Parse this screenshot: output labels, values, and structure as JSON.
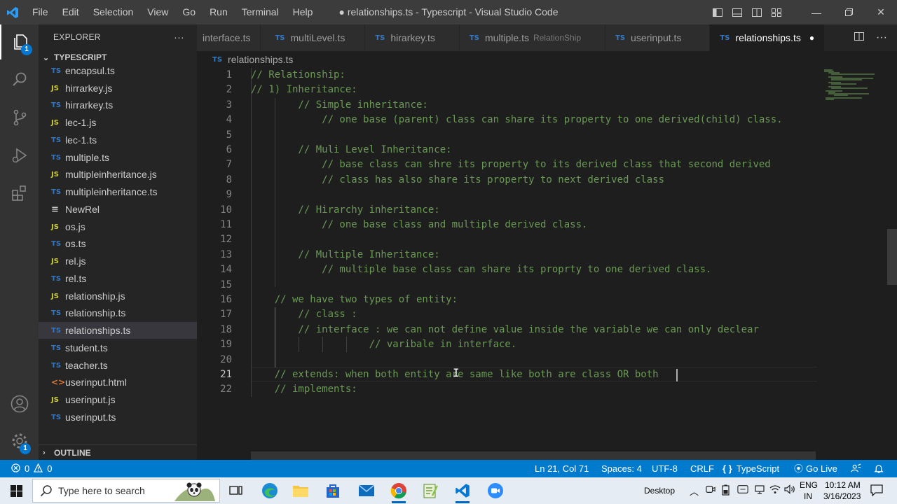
{
  "window": {
    "title": "● relationships.ts - Typescript - Visual Studio Code",
    "menu": [
      "File",
      "Edit",
      "Selection",
      "View",
      "Go",
      "Run",
      "Terminal",
      "Help"
    ]
  },
  "activity": {
    "explorer_badge": "1",
    "settings_badge": "1"
  },
  "sidebar": {
    "title": "EXPLORER",
    "more": "···",
    "folder": "TYPESCRIPT",
    "outline": "OUTLINE",
    "files": [
      {
        "icon": "TS",
        "name": "encapsul.ts"
      },
      {
        "icon": "JS",
        "name": "hirrarkey.js"
      },
      {
        "icon": "TS",
        "name": "hirrarkey.ts"
      },
      {
        "icon": "JS",
        "name": "lec-1.js"
      },
      {
        "icon": "TS",
        "name": "lec-1.ts"
      },
      {
        "icon": "TS",
        "name": "multiple.ts"
      },
      {
        "icon": "JS",
        "name": "multipleinheritance.js"
      },
      {
        "icon": "TS",
        "name": "multipleinheritance.ts"
      },
      {
        "icon": "≡",
        "name": "NewRel"
      },
      {
        "icon": "JS",
        "name": "os.js"
      },
      {
        "icon": "TS",
        "name": "os.ts"
      },
      {
        "icon": "JS",
        "name": "rel.js"
      },
      {
        "icon": "TS",
        "name": "rel.ts"
      },
      {
        "icon": "JS",
        "name": "relationship.js"
      },
      {
        "icon": "TS",
        "name": "relationship.ts"
      },
      {
        "icon": "TS",
        "name": "relationships.ts"
      },
      {
        "icon": "TS",
        "name": "student.ts"
      },
      {
        "icon": "TS",
        "name": "teacher.ts"
      },
      {
        "icon": "<>",
        "name": "userinput.html"
      },
      {
        "icon": "JS",
        "name": "userinput.js"
      },
      {
        "icon": "TS",
        "name": "userinput.ts"
      }
    ]
  },
  "tabs": [
    {
      "name": "interface.ts",
      "desc": ""
    },
    {
      "name": "multiLevel.ts",
      "desc": ""
    },
    {
      "name": "hirarkey.ts",
      "desc": ""
    },
    {
      "name": "multiple.ts",
      "desc": "RelationShip"
    },
    {
      "name": "userinput.ts",
      "desc": ""
    },
    {
      "name": "relationships.ts",
      "desc": ""
    }
  ],
  "tab_icon": "TS",
  "tab_dirty": "●",
  "breadcrumb": "relationships.ts",
  "editor": {
    "lines": [
      "// Relationship:",
      "// 1) Inheritance:",
      "        // Simple inheritance:",
      "            // one base (parent) class can share its property to one derived(child) class.",
      "",
      "        // Muli Level Inheritance:",
      "            // base class can shre its property to its derived class that second derived",
      "            // class has also share its property to next derived class",
      "",
      "        // Hirarchy inheritance:",
      "            // one base class and multiple derived class.",
      "",
      "        // Multiple Inheritance:",
      "            // multiple base class can share its proprty to one derived class.",
      "",
      "    // we have two types of entity:",
      "        // class :",
      "        // interface : we can not define value inside the variable we can only declear",
      "                    // varibale in interface.",
      "",
      "    // extends: when both entity are same like both are class OR both ",
      "    // implements:"
    ],
    "current_line": 21
  },
  "status": {
    "errors": "0",
    "warnings": "0",
    "position": "Ln 21, Col 71",
    "spaces": "Spaces: 4",
    "encoding": "UTF-8",
    "eol": "CRLF",
    "language": "TypeScript",
    "golive": "Go Live"
  },
  "taskbar": {
    "search_placeholder": "Type here to search",
    "desktop": "Desktop",
    "lang1": "ENG",
    "lang2": "IN",
    "time": "10:12 AM",
    "date": "3/16/2023"
  }
}
